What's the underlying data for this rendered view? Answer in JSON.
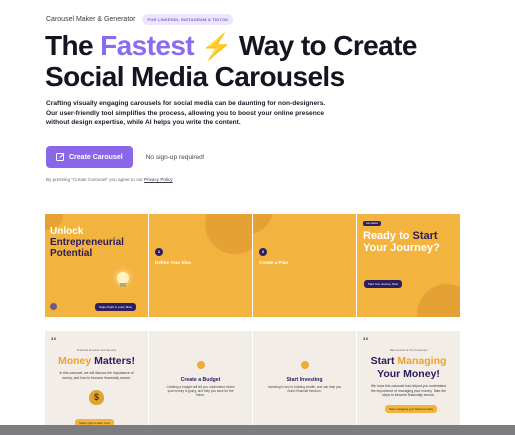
{
  "header": {
    "eyebrow": "Carousel Maker & Generator",
    "badge": "FOR LINKEDIN, INSTAGRAM & TIKTOK"
  },
  "headline": {
    "part1": "The ",
    "accent": "Fastest",
    "bolt": "⚡",
    "part2": " Way to Create",
    "line2": "Social Media Carousels"
  },
  "lead": {
    "line1": "Crafting visually engaging carousels for social media can be daunting for non-designers.",
    "line2": "Our user-friendly tool simplifies the process, allowing you to boost your online presence",
    "line3": "without design expertise, while AI helps you write the content."
  },
  "cta": {
    "button_label": "Create Carousel",
    "note": "No sign-up required!",
    "terms_prefix": "By pressing \"Create Carousel\" you agree to our ",
    "terms_link": "Privacy Policy"
  },
  "carousel_top": {
    "slide1": {
      "title_white": "Unlock",
      "title_rest": " Entrepreneurial",
      "title_line2": "Potential",
      "button": "Swipe Right to Learn More"
    },
    "slide2": {
      "step": "1",
      "title": "Define Your Idea"
    },
    "slide3": {
      "step": "2",
      "title": "Create a Plan"
    },
    "slide4": {
      "pill": "Get started",
      "line1_white": "Ready to ",
      "line1_dark": "Start",
      "line2": "Your Journey?",
      "button": "Start Your Journey Now!"
    }
  },
  "carousel_bottom": {
    "logo": "3X",
    "slide1": {
      "kicker": "Financial Freedom and Security",
      "big_orange": "Money",
      "big_rest": " Matters!",
      "desc": "In this carousel, we will discuss the importance of money, and how to become financially secure.",
      "button": "Swipe right to learn more"
    },
    "slide2": {
      "title": "Create a Budget",
      "desc": "Creating a budget will tell you understand where your money is going, and help you save for the future."
    },
    "slide3": {
      "title": "Start Investing",
      "desc": "Investing is key to building wealth, and can help you reach financial freedom."
    },
    "slide4": {
      "kicker": "Take Control of Your Finances!",
      "big_dark": "Start ",
      "big_orange": "Managing",
      "big_line2": "Your Money!",
      "desc": "We hope this carousel has helped you understand the importance of managing your money. Take the steps to become financially secure.",
      "button": "Start managing your finances today"
    }
  }
}
